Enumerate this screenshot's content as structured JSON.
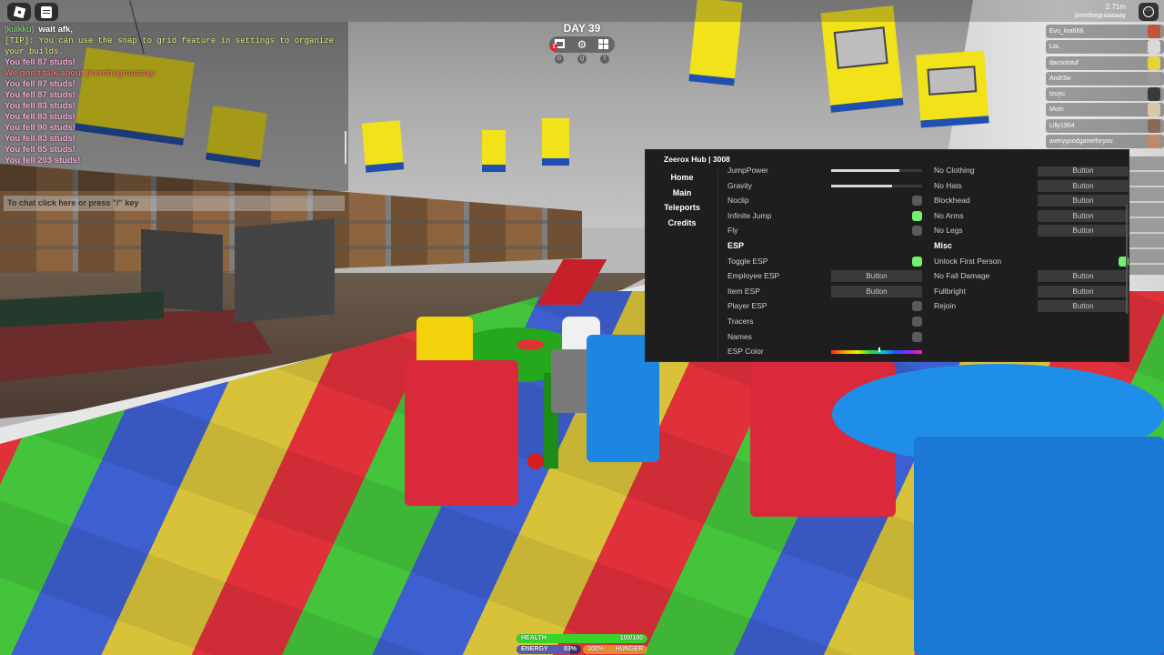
{
  "hud": {
    "day_label": "DAY 39",
    "notification_count": "1",
    "hotkeys": [
      "G",
      "Q",
      "T"
    ],
    "ping": "2.71m",
    "username": "jirenthegraaaaay"
  },
  "chat": {
    "messages": [
      {
        "name": "[kuikku]:",
        "text": "wait afk,",
        "type": "player"
      },
      {
        "text": "[TIP]: You can use the snap to grid feature in settings to organize your builds.",
        "type": "tip"
      },
      {
        "text": "You fell 87 studs!",
        "type": "fall"
      },
      {
        "text": "We don't talk about jirenthegraaaaay",
        "type": "red"
      },
      {
        "text": "You fell 87 studs!",
        "type": "fall"
      },
      {
        "text": "You fell 87 studs!",
        "type": "fall"
      },
      {
        "text": "You fell 83 studs!",
        "type": "fall"
      },
      {
        "text": "You fell 83 studs!",
        "type": "fall"
      },
      {
        "text": "You fell 90 studs!",
        "type": "fall"
      },
      {
        "text": "You fell 83 studs!",
        "type": "fall"
      },
      {
        "text": "You fell 85 studs!",
        "type": "fall"
      },
      {
        "text": "You fell 203 studs!",
        "type": "fall"
      }
    ],
    "input_placeholder": "To chat click here or press \"/\" key"
  },
  "leaderboard": {
    "players": [
      {
        "name": "Evu_kra666",
        "avatar_color": "#c0553a"
      },
      {
        "name": "LoL",
        "avatar_color": "#d8d8d8"
      },
      {
        "name": "dacoolstuf",
        "avatar_color": "#e8d23a"
      },
      {
        "name": "Andr3w",
        "avatar_color": "#9a9a9a"
      },
      {
        "name": "tzuyu",
        "avatar_color": "#3a3a3a"
      },
      {
        "name": "Mom",
        "avatar_color": "#d9c7a5"
      },
      {
        "name": "Lilly1954",
        "avatar_color": "#8a6a55"
      },
      {
        "name": "averygoodgameforyou",
        "avatar_color": "#c08a6a"
      }
    ]
  },
  "hub": {
    "title": "Zeerox Hub | 3008",
    "nav": [
      "Home",
      "Main",
      "Teleports",
      "Credits"
    ],
    "left_column": [
      {
        "label": "JumpPower",
        "control": "slider",
        "value": 0.75
      },
      {
        "label": "Gravity",
        "control": "slider",
        "value": 0.67
      },
      {
        "label": "Noclip",
        "control": "toggle",
        "on": false
      },
      {
        "label": "Infinite Jump",
        "control": "toggle",
        "on": true
      },
      {
        "label": "Fly",
        "control": "toggle",
        "on": false
      },
      {
        "label": "ESP",
        "control": "section"
      },
      {
        "label": "Toggle ESP",
        "control": "toggle",
        "on": true
      },
      {
        "label": "Employee ESP",
        "control": "button",
        "button_label": "Button"
      },
      {
        "label": "Item ESP",
        "control": "button",
        "button_label": "Button"
      },
      {
        "label": "Player ESP",
        "control": "toggle",
        "on": false
      },
      {
        "label": "Tracers",
        "control": "toggle",
        "on": false
      },
      {
        "label": "Names",
        "control": "toggle",
        "on": false
      },
      {
        "label": "ESP Color",
        "control": "color",
        "hue": 0.52
      }
    ],
    "right_column": [
      {
        "label": "No Clothing",
        "control": "button",
        "button_label": "Button"
      },
      {
        "label": "No Hats",
        "control": "button",
        "button_label": "Button"
      },
      {
        "label": "Blockhead",
        "control": "button",
        "button_label": "Button"
      },
      {
        "label": "No Arms",
        "control": "button",
        "button_label": "Button"
      },
      {
        "label": "No Legs",
        "control": "button",
        "button_label": "Button"
      },
      {
        "label": "Misc",
        "control": "section"
      },
      {
        "label": "Unlock First Person",
        "control": "toggle",
        "on": true
      },
      {
        "label": "No Fall Damage",
        "control": "button",
        "button_label": "Button"
      },
      {
        "label": "Fullbright",
        "control": "button",
        "button_label": "Button"
      },
      {
        "label": "Rejoin",
        "control": "button",
        "button_label": "Button"
      }
    ]
  },
  "stats": {
    "health_label": "HEALTH",
    "health_value": "100/100",
    "health_fraction": 1.0,
    "energy_label": "ENERGY",
    "energy_value": "83%",
    "energy_fraction": 0.83,
    "hunger_label": "HUNGER",
    "hunger_value": "100%",
    "hunger_fraction": 1.0
  },
  "colors": {
    "toggle_on": "#71f06e",
    "panel_bg": "#1e1e1e",
    "health": "#39d42b",
    "hunger": "#e88a2a"
  }
}
